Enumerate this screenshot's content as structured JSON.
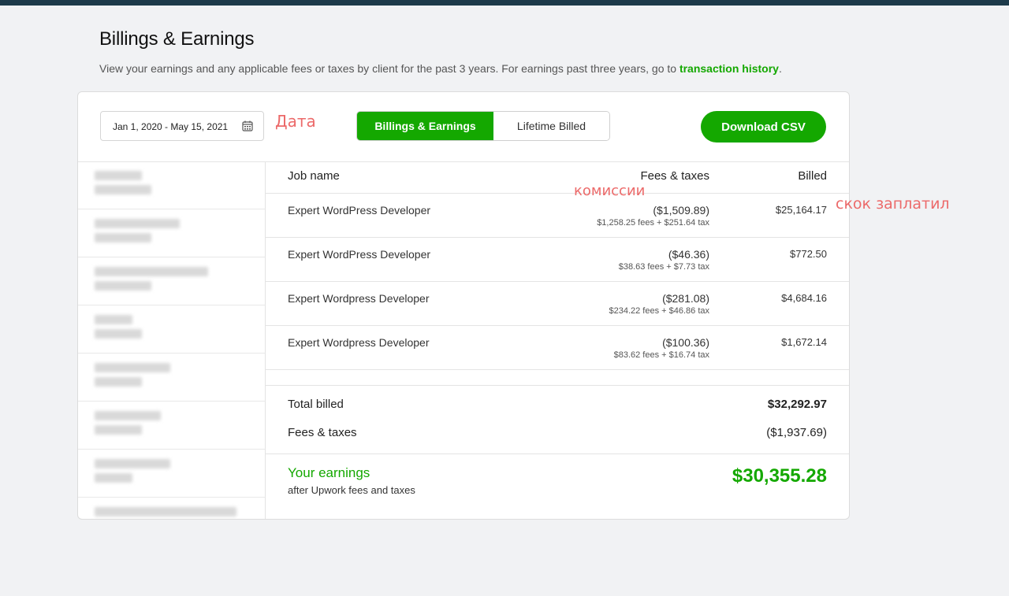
{
  "header": {
    "title": "Billings & Earnings",
    "subtitle": "View your earnings and any applicable fees or taxes by client for the past 3 years. For earnings past three years, go to",
    "link_text": "transaction history",
    "period": "."
  },
  "toolbar": {
    "date_range": "Jan 1, 2020 - May 15, 2021",
    "tabs": [
      {
        "label": "Billings & Earnings",
        "active": true
      },
      {
        "label": "Lifetime Billed",
        "active": false
      }
    ],
    "download_label": "Download CSV"
  },
  "annotations": {
    "date": "Дата",
    "commissions": "комиссии",
    "paid": "скок заплатил"
  },
  "table": {
    "columns": [
      "Job name",
      "Fees & taxes",
      "Billed"
    ],
    "rows": [
      {
        "job": "Expert WordPress Developer",
        "fees": "($1,509.89)",
        "fees_detail": "$1,258.25 fees + $251.64 tax",
        "billed": "$25,164.17"
      },
      {
        "job": "Expert WordPress Developer",
        "fees": "($46.36)",
        "fees_detail": "$38.63 fees + $7.73 tax",
        "billed": "$772.50"
      },
      {
        "job": "Expert Wordpress Developer",
        "fees": "($281.08)",
        "fees_detail": "$234.22 fees + $46.86 tax",
        "billed": "$4,684.16"
      },
      {
        "job": "Expert Wordpress Developer",
        "fees": "($100.36)",
        "fees_detail": "$83.62 fees + $16.74 tax",
        "billed": "$1,672.14"
      }
    ]
  },
  "totals": {
    "total_billed_label": "Total billed",
    "total_billed_value": "$32,292.97",
    "fees_label": "Fees & taxes",
    "fees_value": "($1,937.69)"
  },
  "earnings": {
    "label": "Your earnings",
    "sub": "after Upwork fees and taxes",
    "value": "$30,355.28"
  },
  "colors": {
    "accent": "#14a800",
    "annotation": "#ec6a6a",
    "topbar": "#1d3a4a"
  }
}
